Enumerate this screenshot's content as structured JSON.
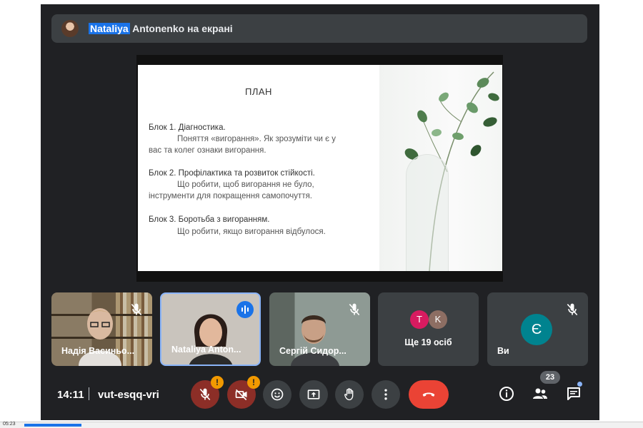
{
  "presenter": {
    "name_highlight": "Nataliya",
    "name_rest": "Antonenko на екрані"
  },
  "slide": {
    "title": "ПЛАН",
    "blocks": [
      {
        "heading": "Блок 1. Діагностика.",
        "lines": [
          "Поняття «вигорання». Як зрозуміти чи є у",
          "вас та колег ознаки вигорання."
        ]
      },
      {
        "heading": "Блок 2. Профілактика та розвиток стійкості.",
        "lines": [
          "Що робити, щоб вигорання не було,",
          "інструменти для покращення самопочуття."
        ]
      },
      {
        "heading": "Блок 3. Боротьба з вигоранням.",
        "lines": [
          "Що робити, якщо вигорання відбулося."
        ]
      }
    ]
  },
  "tiles": [
    {
      "name": "Надія Васиньо...",
      "muted": true
    },
    {
      "name": "Nataliya Anton...",
      "speaking": true
    },
    {
      "name": "Сергій Сидор...",
      "muted": true
    },
    {
      "name": "Ще 19 осіб",
      "avatars": [
        {
          "letter": "T",
          "color": "#d81b60"
        },
        {
          "letter": "K",
          "color": "#8d6e63"
        }
      ]
    },
    {
      "name": "Ви",
      "avatar_letter": "Є",
      "muted": true
    }
  ],
  "meeting": {
    "time": "14:11",
    "code": "vut-esqq-vri",
    "participants_count": "23"
  },
  "status_bar": {
    "time": "05:23"
  },
  "icons": {
    "mic": "mic-off-icon",
    "camera": "camera-off-icon",
    "emoji": "emoji-icon",
    "present": "present-icon",
    "hand": "raise-hand-icon",
    "more": "more-vert-icon",
    "end": "end-call-icon",
    "info": "info-icon",
    "people": "people-icon",
    "chat": "chat-icon"
  },
  "colors": {
    "accent": "#1a73e8",
    "end_call": "#ea4335",
    "warning": "#f29900"
  }
}
